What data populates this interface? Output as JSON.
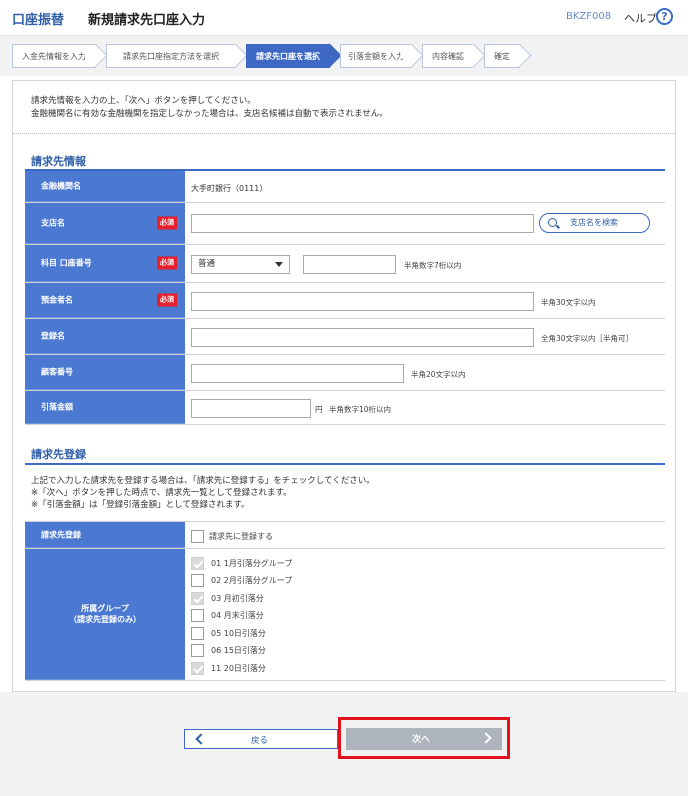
{
  "header": {
    "app_name": "口座振替",
    "page_title": "新規請求先口座入力",
    "screen_code": "BKZF008",
    "help_label": "ヘルプ",
    "help_icon": "?"
  },
  "steps": [
    {
      "label": "入金先情報を入力",
      "active": false
    },
    {
      "label": "請求先口座指定方法を選択",
      "active": false
    },
    {
      "label": "請求先口座を選択",
      "active": true
    },
    {
      "label": "引落金額を入力",
      "active": false
    },
    {
      "label": "内容確認",
      "active": false
    },
    {
      "label": "確定",
      "active": false
    }
  ],
  "intro": {
    "line1": "請求先情報を入力の上、「次へ」ボタンを押してください。",
    "line2": "金融機関名に有効な金融機関を指定しなかった場合は、支店名候補は自動で表示されません。"
  },
  "billing_info": {
    "section_title": "請求先情報",
    "required_badge": "必須",
    "bank_label": "金融機関名",
    "bank_value": "大手町銀行（0111）",
    "branch_label": "支店名",
    "branch_value": "",
    "branch_search_label": "支店名を検索",
    "account_label": "科目 口座番号",
    "account_type_value": "普通",
    "account_number_value": "",
    "account_hint": "半角数字7桁以内",
    "holder_label": "預金者名",
    "holder_value": "",
    "holder_hint": "半角30文字以内",
    "reg_name_label": "登録名",
    "reg_name_value": "",
    "reg_name_hint": "全角30文字以内［半角可］",
    "customer_no_label": "顧客番号",
    "customer_no_value": "",
    "customer_no_hint": "半角20文字以内",
    "amount_label": "引落金額",
    "amount_value": "",
    "amount_unit": "円",
    "amount_hint": "半角数字10桁以内"
  },
  "registration": {
    "section_title": "請求先登録",
    "desc1": "上記で入力した請求先を登録する場合は、「請求先に登録する」をチェックしてください。",
    "desc2": "※「次へ」ボタンを押した時点で、請求先一覧として登録されます。",
    "desc3": "※「引落金額」は「登録引落金額」として登録されます。",
    "register_label": "請求先登録",
    "register_checkbox_label": "請求先に登録する",
    "register_checked": false,
    "group_label_1": "所属グループ",
    "group_label_2": "（請求先登録のみ）",
    "groups": [
      {
        "label": "01 1月引落分グループ",
        "checked": true
      },
      {
        "label": "02 2月引落分グループ",
        "checked": false
      },
      {
        "label": "03 月初引落分",
        "checked": true
      },
      {
        "label": "04 月末引落分",
        "checked": false
      },
      {
        "label": "05 10日引落分",
        "checked": false
      },
      {
        "label": "06 15日引落分",
        "checked": false
      },
      {
        "label": "11 20日引落分",
        "checked": true
      }
    ]
  },
  "footer": {
    "back_label": "戻る",
    "next_label": "次へ"
  },
  "colors": {
    "accent": "#3d69c4",
    "label_bg": "#4b78d1",
    "required": "#e51f2b",
    "highlight_frame": "#e1111d",
    "next_disabled": "#adb4bc"
  }
}
